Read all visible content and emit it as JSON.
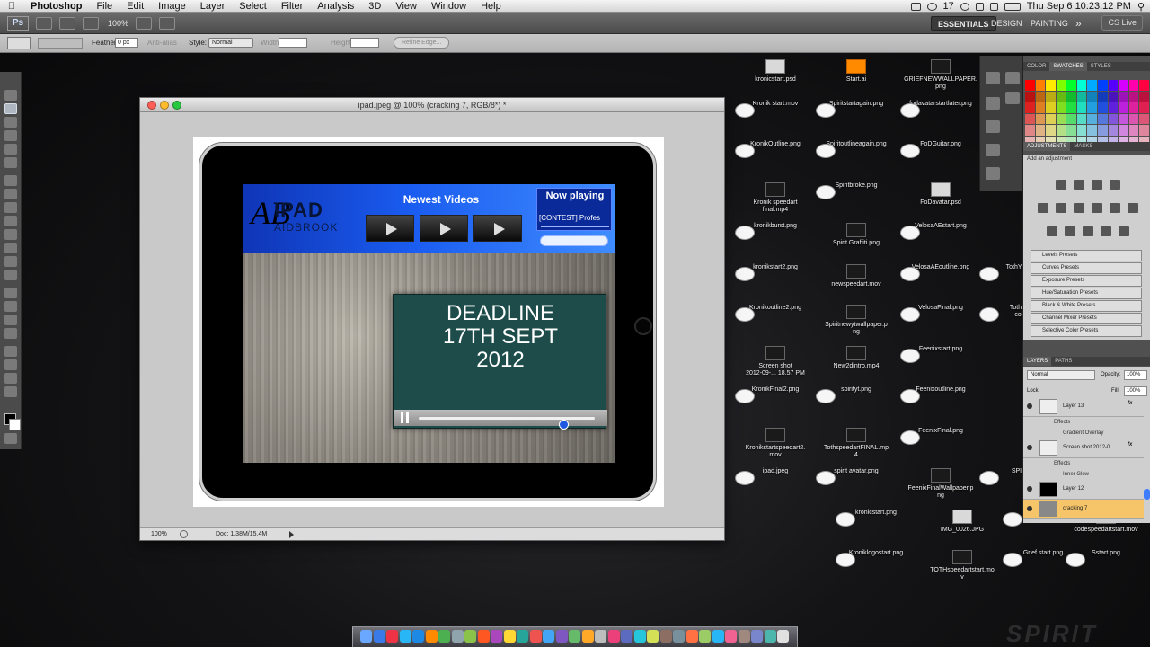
{
  "menubar": {
    "app": "Photoshop",
    "items": [
      "File",
      "Edit",
      "Image",
      "Layer",
      "Select",
      "Filter",
      "Analysis",
      "3D",
      "View",
      "Window",
      "Help"
    ],
    "status_num": "17",
    "clock": "Thu Sep 6  10:23:12 PM"
  },
  "appbar": {
    "logo": "Ps",
    "zoom": "100%",
    "workspaces": [
      "ESSENTIALS",
      "DESIGN",
      "PAINTING"
    ],
    "more": "»",
    "cslive": "CS Live"
  },
  "options": {
    "feather_label": "Feather:",
    "feather_value": "0 px",
    "antialias": "Anti-alias",
    "style_label": "Style:",
    "style_value": "Normal",
    "width_label": "Width:",
    "height_label": "Height:",
    "refine": "Refine Edge..."
  },
  "document": {
    "title": "ipad.jpeg @ 100% (cracking 7, RGB/8*) *",
    "zoom": "100%",
    "doc_size": "Doc: 1.38M/15.4M"
  },
  "artwork": {
    "logo_ab": "AB",
    "logo_ipad": "IPAD",
    "logo_sub": "AIDBROOK",
    "newest_videos": "Newest Videos",
    "now_playing": "Now playing",
    "track": "[CONTEST] Profes",
    "deadline_lines": [
      "DEADLINE",
      "17TH SEPT",
      "2012"
    ],
    "scrub_progress": 0.82
  },
  "desktop_icons": [
    {
      "label": "kronicstart.psd",
      "kind": "psd"
    },
    {
      "label": "Start.ai",
      "kind": "ai"
    },
    {
      "label": "GRIEFNEWWALLPAPER.\npng",
      "kind": "dark"
    },
    {
      "label": "Kronik start.mov",
      "kind": "light"
    },
    {
      "label": "Spiritstartagain.png",
      "kind": "light"
    },
    {
      "label": "fodavatarstartlater.png",
      "kind": "light"
    },
    {
      "label": "KronikOutline.png",
      "kind": "light"
    },
    {
      "label": "Spiritoutlineagain.png",
      "kind": "light"
    },
    {
      "label": "FoDGuitar.png",
      "kind": "light"
    },
    {
      "label": "Kronik speedart\nfinal.mp4",
      "kind": "dark"
    },
    {
      "label": "Spiritbroke.png",
      "kind": "light"
    },
    {
      "label": "FoDavatar.psd",
      "kind": "psd"
    },
    {
      "label": "kronikburst.png",
      "kind": "light"
    },
    {
      "label": "Spirit Graffiti.png",
      "kind": "dark"
    },
    {
      "label": "VelosaAEstart.png",
      "kind": "light"
    },
    {
      "label": "kronikstart2.png",
      "kind": "light"
    },
    {
      "label": "newspeedart.mov",
      "kind": "dark"
    },
    {
      "label": "VelosaAEoutline.png",
      "kind": "light"
    },
    {
      "label": "TothYTwa",
      "kind": "light"
    },
    {
      "label": "Kronikoutline2.png",
      "kind": "light"
    },
    {
      "label": "Spiritnewytwallpaper.p\nng",
      "kind": "dark"
    },
    {
      "label": "VelosaFinal.png",
      "kind": "light"
    },
    {
      "label": "TothYT\ncop",
      "kind": "light"
    },
    {
      "label": "Screen shot\n2012-09-... 18.57 PM",
      "kind": "dark"
    },
    {
      "label": "New2dintro.mp4",
      "kind": "dark"
    },
    {
      "label": "Feenixstart.png",
      "kind": "light"
    },
    {
      "label": "KronikFinal2.png",
      "kind": "light"
    },
    {
      "label": "spirityt.png",
      "kind": "light"
    },
    {
      "label": "Feenixoutline.png",
      "kind": "light"
    },
    {
      "label": "Kronikstartspeedart2.\nmov",
      "kind": "dark"
    },
    {
      "label": "TothspeedartFINAL.mp\n4",
      "kind": "dark"
    },
    {
      "label": "FeenixFinal.png",
      "kind": "light"
    },
    {
      "label": "ipad.jpeg",
      "kind": "light"
    },
    {
      "label": "spirit avatar.png",
      "kind": "light"
    },
    {
      "label": "FeenixFinalWallpaper.p\nng",
      "kind": "dark"
    },
    {
      "label": "SPIRI",
      "kind": "light"
    },
    {
      "label": "kronicstart.png",
      "kind": "light"
    },
    {
      "label": "IMG_0026.JPG",
      "kind": "psd"
    },
    {
      "label": "SpiritFinal.png",
      "kind": "light"
    },
    {
      "label": "codespeedartstart.mov",
      "kind": "dark"
    },
    {
      "label": "Kroniklogostart.png",
      "kind": "light"
    },
    {
      "label": "TOTHspeedartstart.mo\nv",
      "kind": "dark"
    },
    {
      "label": "Grief start.png",
      "kind": "light"
    },
    {
      "label": "Sstart.png",
      "kind": "light"
    }
  ],
  "color_panel": {
    "tabs": [
      "COLOR",
      "SWATCHES",
      "STYLES"
    ]
  },
  "adjustments": {
    "tabs": [
      "ADJUSTMENTS",
      "MASKS"
    ],
    "add_label": "Add an adjustment",
    "presets": [
      "Levels Presets",
      "Curves Presets",
      "Exposure Presets",
      "Hue/Saturation Presets",
      "Black & White Presets",
      "Channel Mixer Presets",
      "Selective Color Presets"
    ]
  },
  "layers": {
    "tabs": [
      "LAYERS",
      "PATHS"
    ],
    "blend": "Normal",
    "opacity_label": "Opacity:",
    "opacity": "100%",
    "lock_label": "Lock:",
    "fill_label": "Fill:",
    "fill": "100%",
    "fx": "fx",
    "layer13": "Layer 13",
    "effects": "Effects",
    "gradient_overlay": "Gradient Overlay",
    "screenshot_layer": "Screen shot 2012-0...",
    "inner_glow": "Inner Glow",
    "layer12": "Layer 12",
    "cracking": "cracking 7"
  },
  "watermark": "SPIRIT"
}
